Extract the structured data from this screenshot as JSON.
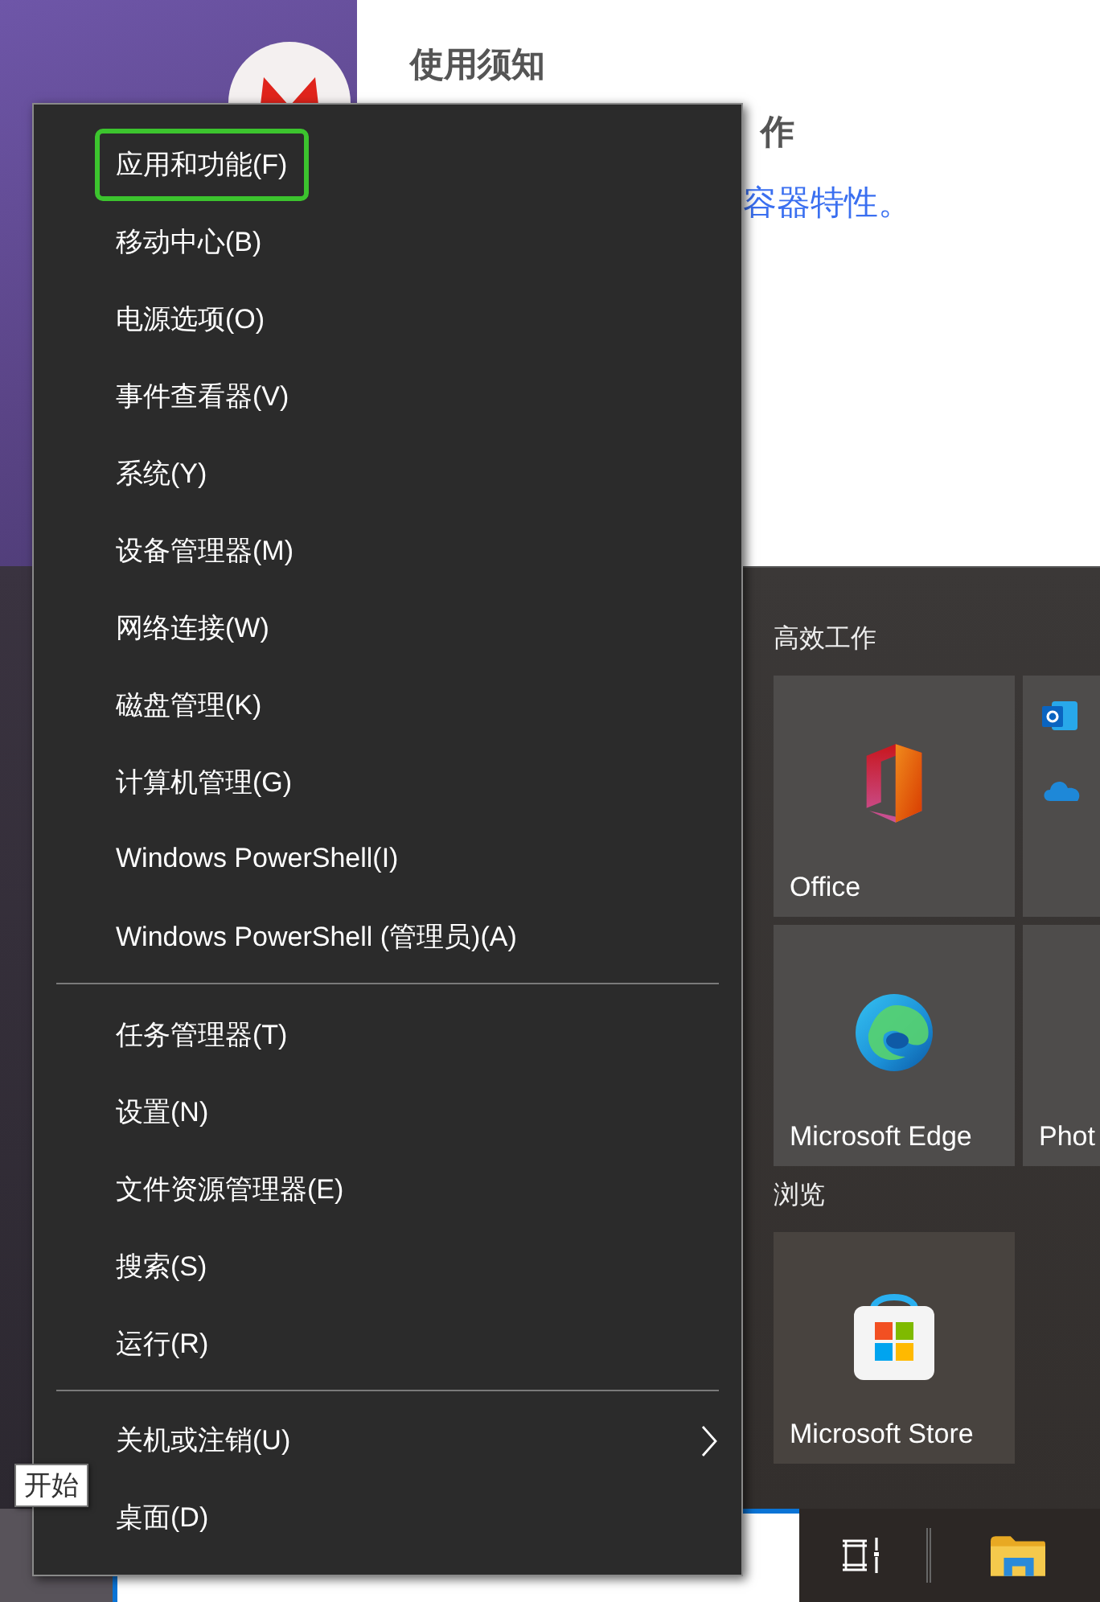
{
  "web_page": {
    "heading": "使用须知",
    "subheading": "作",
    "link": "容器特性。"
  },
  "context_menu": {
    "groups": [
      [
        {
          "label": "应用和功能(F)",
          "highlighted": true,
          "submenu": false
        },
        {
          "label": "移动中心(B)",
          "highlighted": false,
          "submenu": false
        },
        {
          "label": "电源选项(O)",
          "highlighted": false,
          "submenu": false
        },
        {
          "label": "事件查看器(V)",
          "highlighted": false,
          "submenu": false
        },
        {
          "label": "系统(Y)",
          "highlighted": false,
          "submenu": false
        },
        {
          "label": "设备管理器(M)",
          "highlighted": false,
          "submenu": false
        },
        {
          "label": "网络连接(W)",
          "highlighted": false,
          "submenu": false
        },
        {
          "label": "磁盘管理(K)",
          "highlighted": false,
          "submenu": false
        },
        {
          "label": "计算机管理(G)",
          "highlighted": false,
          "submenu": false
        },
        {
          "label": "Windows PowerShell(I)",
          "highlighted": false,
          "submenu": false
        },
        {
          "label": "Windows PowerShell (管理员)(A)",
          "highlighted": false,
          "submenu": false
        }
      ],
      [
        {
          "label": "任务管理器(T)",
          "highlighted": false,
          "submenu": false
        },
        {
          "label": "设置(N)",
          "highlighted": false,
          "submenu": false
        },
        {
          "label": "文件资源管理器(E)",
          "highlighted": false,
          "submenu": false
        },
        {
          "label": "搜索(S)",
          "highlighted": false,
          "submenu": false
        },
        {
          "label": "运行(R)",
          "highlighted": false,
          "submenu": false
        }
      ],
      [
        {
          "label": "关机或注销(U)",
          "highlighted": false,
          "submenu": true
        },
        {
          "label": "桌面(D)",
          "highlighted": false,
          "submenu": false
        }
      ]
    ]
  },
  "start_menu": {
    "groups": [
      {
        "title": "高效工作",
        "tiles": [
          {
            "kind": "office",
            "label": "Office"
          },
          {
            "kind": "mail-cloud"
          },
          {
            "kind": "edge",
            "label": "Microsoft Edge"
          },
          {
            "kind": "plain",
            "label": "Phot"
          }
        ]
      },
      {
        "title": "浏览",
        "tiles": [
          {
            "kind": "store",
            "label": "Microsoft Store"
          }
        ]
      }
    ]
  },
  "tooltip": "开始"
}
